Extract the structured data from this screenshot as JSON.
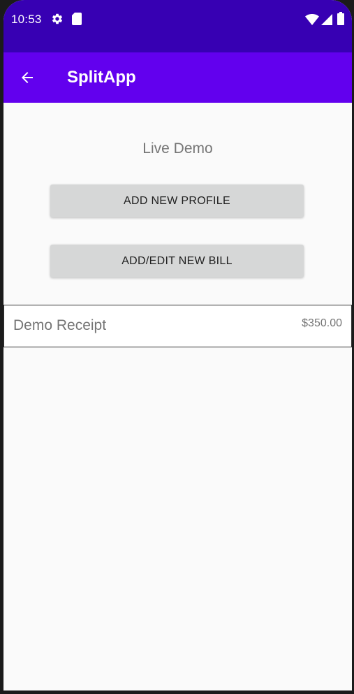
{
  "status_bar": {
    "time": "10:53",
    "icons": [
      "gear-icon",
      "sd-card-icon",
      "wifi-icon",
      "signal-icon",
      "battery-icon"
    ]
  },
  "app_bar": {
    "title": "SplitApp",
    "back_icon": "arrow-back-icon"
  },
  "main": {
    "subtitle": "Live Demo",
    "add_profile_label": "ADD NEW PROFILE",
    "add_bill_label": "ADD/EDIT NEW BILL"
  },
  "bills": [
    {
      "name": "Demo Receipt",
      "amount": "$350.00"
    }
  ],
  "colors": {
    "status_bar": "#3700b3",
    "app_bar": "#6200ee",
    "background": "#fafafa",
    "button": "#d6d7d7",
    "secondary_text": "#757575"
  }
}
